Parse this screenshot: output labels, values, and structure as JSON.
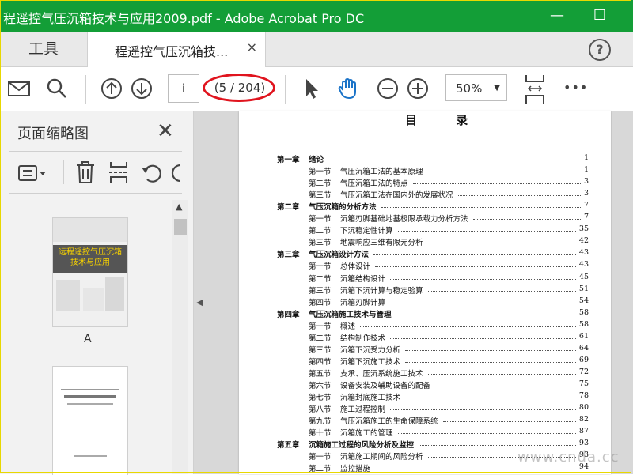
{
  "window": {
    "title": "程遥控气压沉箱技术与应用2009.pdf - Adobe Acrobat Pro DC",
    "minimize": "—",
    "maximize": "☐"
  },
  "tabs": {
    "tools_label": "工具",
    "doc_label": "程遥控气压沉箱技...",
    "close": "×",
    "help": "?"
  },
  "toolbar": {
    "page_input": "i",
    "page_count": "(5 / 204)",
    "zoom": "50%",
    "more": "•••"
  },
  "sidepanel": {
    "title": "页面缩略图",
    "close": "✕",
    "thumb1_title": "远程遥控气压沉箱技术与应用",
    "thumb1_label": "A"
  },
  "toc": {
    "title": "目 录",
    "rows": [
      {
        "level": "chapter",
        "num": "第一章",
        "text": "绪论",
        "page": "1"
      },
      {
        "level": "section",
        "num": "第一节",
        "text": "气压沉箱工法的基本原理",
        "page": "1"
      },
      {
        "level": "section",
        "num": "第二节",
        "text": "气压沉箱工法的特点",
        "page": "3"
      },
      {
        "level": "section",
        "num": "第三节",
        "text": "气压沉箱工法在国内外的发展状况",
        "page": "3"
      },
      {
        "level": "chapter",
        "num": "第二章",
        "text": "气压沉箱的分析方法",
        "page": "7"
      },
      {
        "level": "section",
        "num": "第一节",
        "text": "沉箱刃脚基础地基极限承载力分析方法",
        "page": "7"
      },
      {
        "level": "section",
        "num": "第二节",
        "text": "下沉稳定性计算",
        "page": "35"
      },
      {
        "level": "section",
        "num": "第三节",
        "text": "地震响应三维有限元分析",
        "page": "42"
      },
      {
        "level": "chapter",
        "num": "第三章",
        "text": "气压沉箱设计方法",
        "page": "43"
      },
      {
        "level": "section",
        "num": "第一节",
        "text": "总体设计",
        "page": "43"
      },
      {
        "level": "section",
        "num": "第二节",
        "text": "沉箱结构设计",
        "page": "45"
      },
      {
        "level": "section",
        "num": "第三节",
        "text": "沉箱下沉计算与稳定验算",
        "page": "51"
      },
      {
        "level": "section",
        "num": "第四节",
        "text": "沉箱刃脚计算",
        "page": "54"
      },
      {
        "level": "chapter",
        "num": "第四章",
        "text": "气压沉箱施工技术与管理",
        "page": "58"
      },
      {
        "level": "section",
        "num": "第一节",
        "text": "概述",
        "page": "58"
      },
      {
        "level": "section",
        "num": "第二节",
        "text": "结构制作技术",
        "page": "61"
      },
      {
        "level": "section",
        "num": "第三节",
        "text": "沉箱下沉受力分析",
        "page": "64"
      },
      {
        "level": "section",
        "num": "第四节",
        "text": "沉箱下沉施工技术",
        "page": "69"
      },
      {
        "level": "section",
        "num": "第五节",
        "text": "支承、压沉系统施工技术",
        "page": "72"
      },
      {
        "level": "section",
        "num": "第六节",
        "text": "设备安装及辅助设备的配备",
        "page": "75"
      },
      {
        "level": "section",
        "num": "第七节",
        "text": "沉箱封底施工技术",
        "page": "78"
      },
      {
        "level": "section",
        "num": "第八节",
        "text": "施工过程控制",
        "page": "80"
      },
      {
        "level": "section",
        "num": "第九节",
        "text": "气压沉箱施工的生命保障系统",
        "page": "82"
      },
      {
        "level": "section",
        "num": "第十节",
        "text": "沉箱施工的管理",
        "page": "87"
      },
      {
        "level": "chapter",
        "num": "第五章",
        "text": "沉箱施工过程的风险分析及监控",
        "page": "93"
      },
      {
        "level": "section",
        "num": "第一节",
        "text": "沉箱施工期间的风险分析",
        "page": "93"
      },
      {
        "level": "section",
        "num": "第二节",
        "text": "监控措施",
        "page": "94"
      }
    ]
  },
  "watermark": "www.cnda.cc"
}
